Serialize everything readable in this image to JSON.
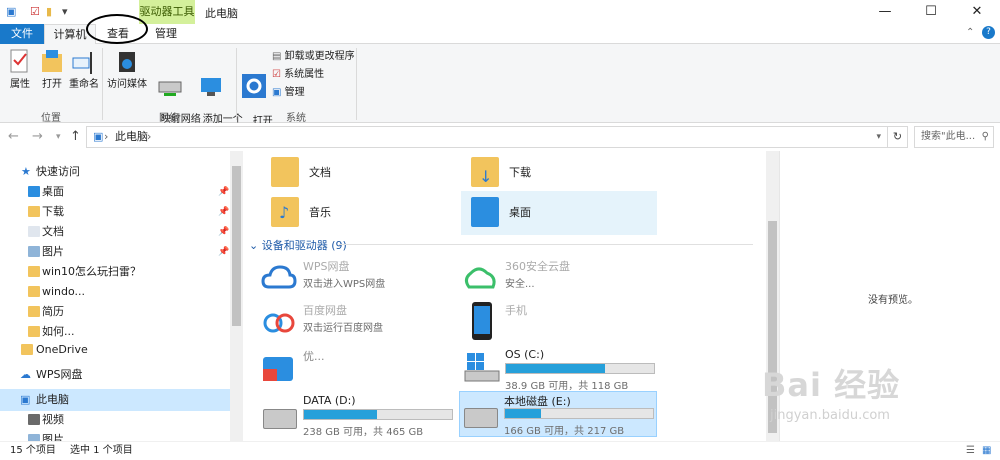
{
  "titlebar": {
    "ctx_tab": "驱动器工具",
    "title": "此电脑",
    "minimize": "—",
    "maximize": "☐",
    "close": "✕",
    "dropdown": "▾"
  },
  "tabs": {
    "file": "文件",
    "computer": "计算机",
    "view": "查看",
    "manage": "管理"
  },
  "ribbon": {
    "properties": "属性",
    "open": "打开",
    "rename": "重命名",
    "group_location": "位置",
    "access_media": "访问媒体",
    "map_network_drive": "映射网络\n驱动器",
    "add_network_location": "添加一个\n网络位置",
    "group_network": "网络",
    "open_settings": "打开\n设置",
    "uninstall": "卸载或更改程序",
    "system_props": "系统属性",
    "manage": "管理",
    "group_system": "系统"
  },
  "address": {
    "path": "此电脑",
    "chevron": "›",
    "search_placeholder": "搜索\"此电...",
    "refresh": "↻"
  },
  "nav": {
    "quick_access": "快速访问",
    "items": [
      "桌面",
      "下载",
      "文档",
      "图片",
      "win10怎么玩扫雷？",
      "windo...",
      "简历",
      "如何..."
    ],
    "onedrive": "OneDrive",
    "wps": "WPS网盘",
    "this_pc": "此电脑",
    "video": "视频",
    "pictures": "图片"
  },
  "content": {
    "folders": [
      "文档",
      "下载",
      "音乐",
      "桌面"
    ],
    "section": "设备和驱动器 (9)",
    "devices": [
      {
        "name": "WPS网盘",
        "sub": "双击进入WPS网盘"
      },
      {
        "name": "360安全云盘",
        "sub": "安全..."
      },
      {
        "name": "百度网盘",
        "sub": "双击运行百度网盘"
      },
      {
        "name": "手机",
        "sub": ""
      },
      {
        "name": "优...",
        "sub": ""
      }
    ],
    "drives": [
      {
        "name": "OS (C:)",
        "sub": "38.9 GB 可用，共 118 GB",
        "used": 0.67
      },
      {
        "name": "DATA (D:)",
        "sub": "238 GB 可用，共 465 GB",
        "used": 0.49
      },
      {
        "name": "本地磁盘 (E:)",
        "sub": "166 GB 可用，共 217 GB",
        "used": 0.24
      }
    ]
  },
  "preview": {
    "text": "没有预览。"
  },
  "watermark": {
    "text": "Bai 经验",
    "sub": "jingyan.baidu.com"
  },
  "status": {
    "count": "15 个项目",
    "selected": "选中 1 个项目"
  }
}
